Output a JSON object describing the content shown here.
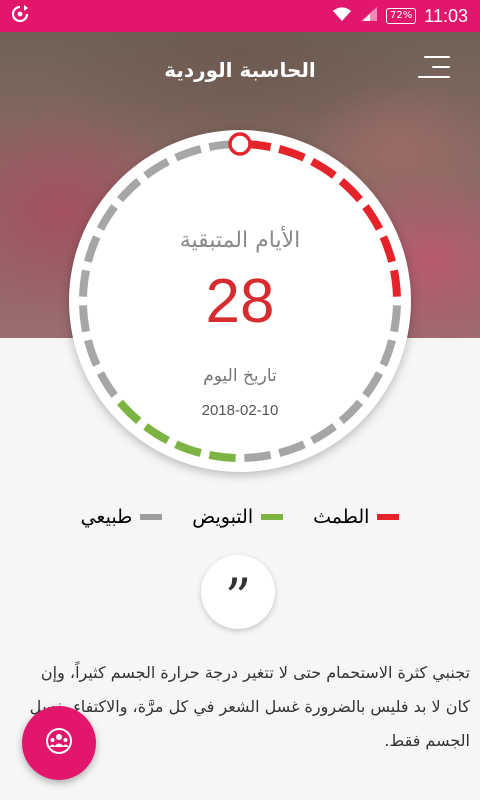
{
  "status_bar": {
    "battery": "72%",
    "time": "11:03"
  },
  "header": {
    "title": "الحاسبة الوردية"
  },
  "dial": {
    "remaining_label": "الأيام المتبقية",
    "remaining_days": "28",
    "today_label": "تاريخ اليوم",
    "today_date": "2018-02-10",
    "cycle_segments": 28,
    "period_segments": 7,
    "ovulation_start_segment": 14,
    "ovulation_segments": 4,
    "colors": {
      "period": "#e5232a",
      "ovulation": "#7cb342",
      "normal": "#a6a6a6"
    }
  },
  "legend": [
    {
      "label": "الطمث",
      "color": "#e5232a"
    },
    {
      "label": "التبويض",
      "color": "#7cb342"
    },
    {
      "label": "طبيعي",
      "color": "#9e9e9e"
    }
  ],
  "tip": {
    "text": "تجنبي كثرة الاستحمام حتى لا تتغير درجة حرارة الجسم كثيراً، وإن كان لا بد فليس بالضرورة غسل الشعر في كل مرَّة، والاكتفاء بغسل الجسم فقط."
  },
  "icons": {
    "menu": "menu-icon",
    "quote": "quote-icon",
    "fab": "community-icon"
  }
}
